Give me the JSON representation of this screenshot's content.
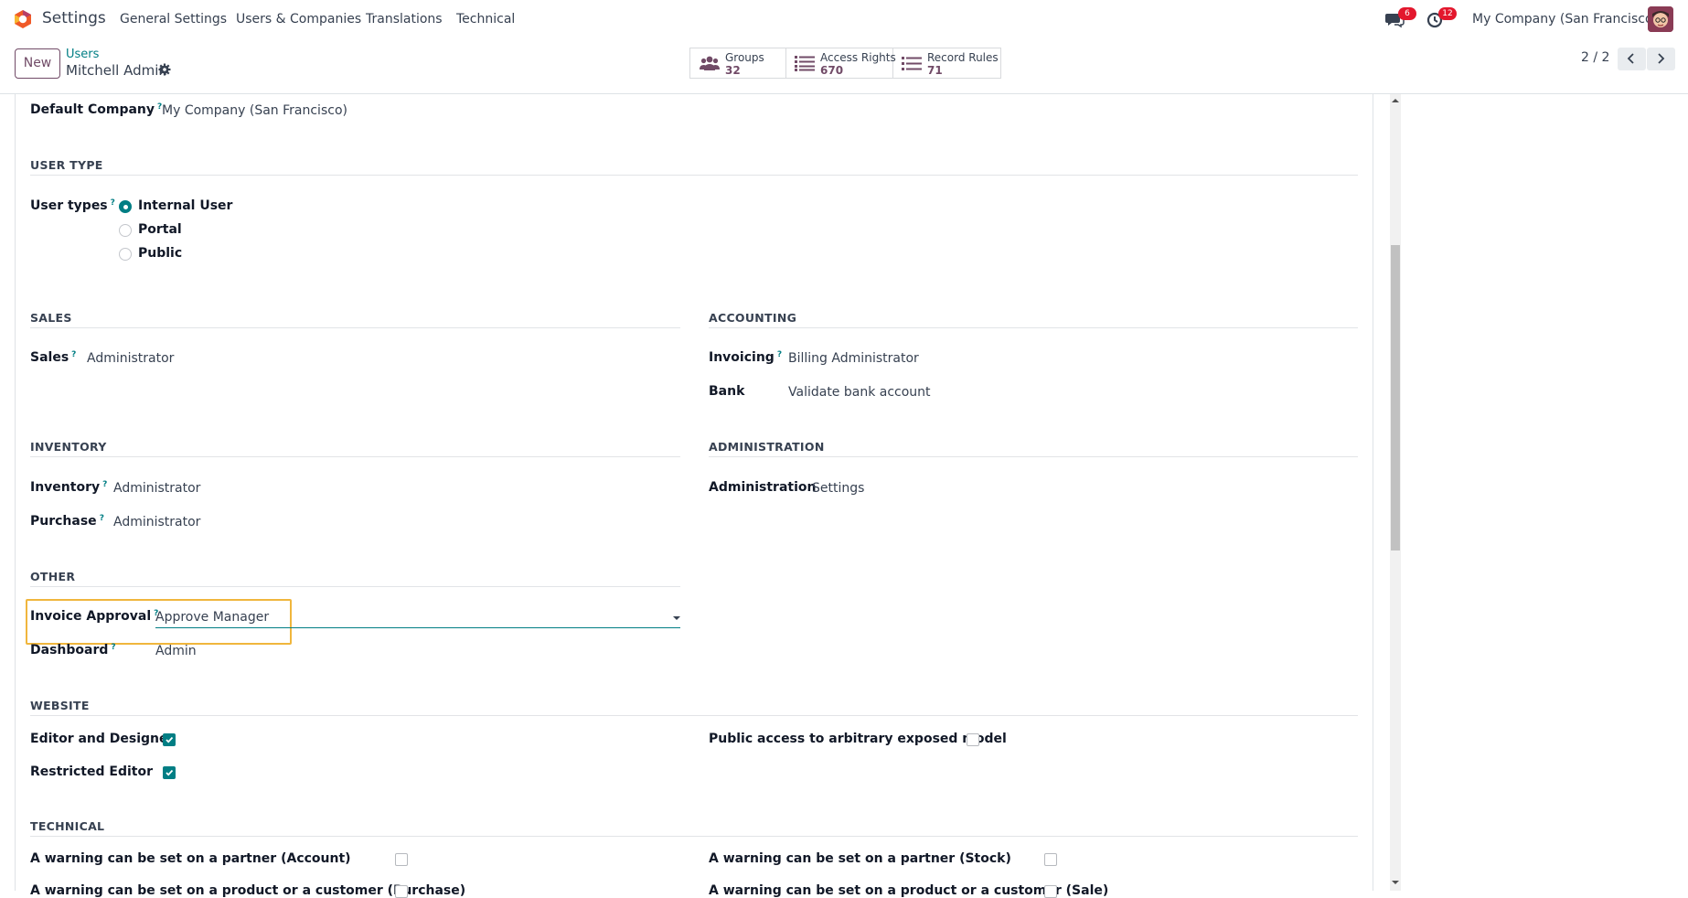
{
  "app": {
    "name": "Settings"
  },
  "menu": [
    "General Settings",
    "Users & Companies",
    "Translations",
    "Technical"
  ],
  "systray": {
    "messages_badge": "6",
    "activity_badge": "12",
    "company": "My Company (San Francisco)"
  },
  "control": {
    "new_label": "New",
    "breadcrumb_parent": "Users",
    "breadcrumb_current": "Mitchell Admin",
    "stats": [
      {
        "label": "Groups",
        "value": "32",
        "icon": "users-icon"
      },
      {
        "label": "Access Rights",
        "value": "670",
        "icon": "list-icon"
      },
      {
        "label": "Record Rules",
        "value": "71",
        "icon": "list-icon"
      }
    ],
    "pager": "2 / 2"
  },
  "form": {
    "default_company": {
      "label": "Default Company",
      "value": "My Company (San Francisco)"
    },
    "user_type": {
      "title": "USER TYPE",
      "label": "User types",
      "options": [
        "Internal User",
        "Portal",
        "Public"
      ],
      "selected": "Internal User"
    },
    "sales": {
      "title": "SALES",
      "label": "Sales",
      "value": "Administrator"
    },
    "accounting": {
      "title": "ACCOUNTING",
      "invoicing_label": "Invoicing",
      "invoicing_value": "Billing Administrator",
      "bank_label": "Bank",
      "bank_value": "Validate bank account"
    },
    "inventory": {
      "title": "INVENTORY",
      "inventory_label": "Inventory",
      "inventory_value": "Administrator",
      "purchase_label": "Purchase",
      "purchase_value": "Administrator"
    },
    "administration": {
      "title": "ADMINISTRATION",
      "label": "Administration",
      "value": "Settings"
    },
    "other": {
      "title": "OTHER",
      "invoice_approval_label": "Invoice Approval",
      "invoice_approval_value": "Approve Manager",
      "dashboard_label": "Dashboard",
      "dashboard_value": "Admin"
    },
    "website": {
      "title": "WEBSITE",
      "editor_label": "Editor and Designer",
      "editor_checked": true,
      "restricted_label": "Restricted Editor",
      "restricted_checked": true,
      "public_access_label": "Public access to arbitrary exposed model",
      "public_access_checked": false
    },
    "technical": {
      "title": "TECHNICAL",
      "warn_partner_account": "A warning can be set on a partner (Account)",
      "warn_partner_stock": "A warning can be set on a partner (Stock)",
      "warn_product_purchase": "A warning can be set on a product or a customer (Purchase)",
      "warn_product_sale": "A warning can be set on a product or a customer (Sale)"
    },
    "help_marker": "?"
  },
  "colors": {
    "brand": "#714b67",
    "accent": "#017e84",
    "highlight": "#f0b63d",
    "badge": "#e3172d"
  }
}
